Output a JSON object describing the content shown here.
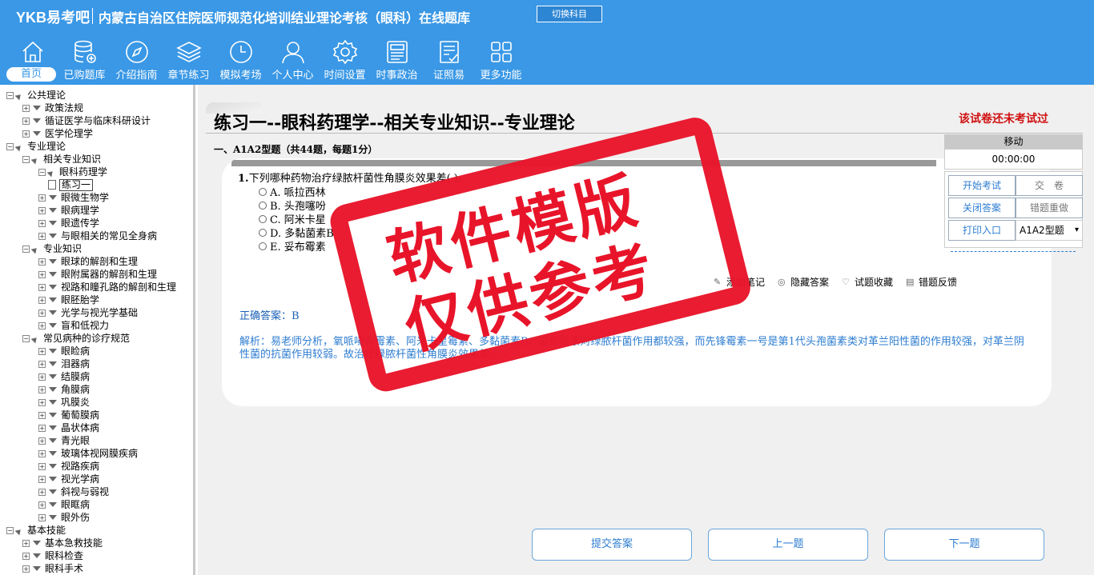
{
  "header": {
    "brand": "YKB易考吧",
    "title": "内蒙古自治区住院医师规范化培训结业理论考核（眼科）在线题库",
    "switch_label": "切换科目"
  },
  "nav": [
    {
      "label": "首页",
      "icon": "home-icon"
    },
    {
      "label": "已购题库",
      "icon": "database-icon"
    },
    {
      "label": "介绍指南",
      "icon": "compass-icon"
    },
    {
      "label": "章节练习",
      "icon": "layers-icon"
    },
    {
      "label": "模拟考场",
      "icon": "clock-icon"
    },
    {
      "label": "个人中心",
      "icon": "user-icon"
    },
    {
      "label": "时间设置",
      "icon": "gear-icon"
    },
    {
      "label": "时事政治",
      "icon": "news-icon"
    },
    {
      "label": "证照易",
      "icon": "certificate-icon"
    },
    {
      "label": "更多功能",
      "icon": "grid-icon"
    }
  ],
  "tree": [
    {
      "level": 0,
      "label": "公共理论",
      "box": "−",
      "tri": "open"
    },
    {
      "level": 1,
      "label": "政策法规",
      "box": "+",
      "tri": "closed"
    },
    {
      "level": 1,
      "label": "循证医学与临床科研设计",
      "box": "+",
      "tri": "closed"
    },
    {
      "level": 1,
      "label": "医学伦理学",
      "box": "+",
      "tri": "closed"
    },
    {
      "level": 0,
      "label": "专业理论",
      "box": "−",
      "tri": "open"
    },
    {
      "level": 1,
      "label": "相关专业知识",
      "box": "−",
      "tri": "open"
    },
    {
      "level": 2,
      "label": "眼科药理学",
      "box": "−",
      "tri": "open"
    },
    {
      "level": 3,
      "label": "练习一",
      "leaf": true
    },
    {
      "level": 2,
      "label": "眼微生物学",
      "box": "+",
      "tri": "closed"
    },
    {
      "level": 2,
      "label": "眼病理学",
      "box": "+",
      "tri": "closed"
    },
    {
      "level": 2,
      "label": "眼遗传学",
      "box": "+",
      "tri": "closed"
    },
    {
      "level": 2,
      "label": "与眼相关的常见全身病",
      "box": "+",
      "tri": "closed"
    },
    {
      "level": 1,
      "label": "专业知识",
      "box": "−",
      "tri": "open"
    },
    {
      "level": 2,
      "label": "眼球的解剖和生理",
      "box": "+",
      "tri": "closed"
    },
    {
      "level": 2,
      "label": "眼附属器的解剖和生理",
      "box": "+",
      "tri": "closed"
    },
    {
      "level": 2,
      "label": "视路和瞳孔路的解剖和生理",
      "box": "+",
      "tri": "closed"
    },
    {
      "level": 2,
      "label": "眼胚胎学",
      "box": "+",
      "tri": "closed"
    },
    {
      "level": 2,
      "label": "光学与视光学基础",
      "box": "+",
      "tri": "closed"
    },
    {
      "level": 2,
      "label": "盲和低视力",
      "box": "+",
      "tri": "closed"
    },
    {
      "level": 1,
      "label": "常见病种的诊疗规范",
      "box": "−",
      "tri": "open"
    },
    {
      "level": 2,
      "label": "眼睑病",
      "box": "+",
      "tri": "closed"
    },
    {
      "level": 2,
      "label": "泪器病",
      "box": "+",
      "tri": "closed"
    },
    {
      "level": 2,
      "label": "结膜病",
      "box": "+",
      "tri": "closed"
    },
    {
      "level": 2,
      "label": "角膜病",
      "box": "+",
      "tri": "closed"
    },
    {
      "level": 2,
      "label": "巩膜炎",
      "box": "+",
      "tri": "closed"
    },
    {
      "level": 2,
      "label": "葡萄膜病",
      "box": "+",
      "tri": "closed"
    },
    {
      "level": 2,
      "label": "晶状体病",
      "box": "+",
      "tri": "closed"
    },
    {
      "level": 2,
      "label": "青光眼",
      "box": "+",
      "tri": "closed"
    },
    {
      "level": 2,
      "label": "玻璃体视网膜疾病",
      "box": "+",
      "tri": "closed"
    },
    {
      "level": 2,
      "label": "视路疾病",
      "box": "+",
      "tri": "closed"
    },
    {
      "level": 2,
      "label": "视光学病",
      "box": "+",
      "tri": "closed"
    },
    {
      "level": 2,
      "label": "斜视与弱视",
      "box": "+",
      "tri": "closed"
    },
    {
      "level": 2,
      "label": "眼眶病",
      "box": "+",
      "tri": "closed"
    },
    {
      "level": 2,
      "label": "眼外伤",
      "box": "+",
      "tri": "closed"
    },
    {
      "level": 0,
      "label": "基本技能",
      "box": "−",
      "tri": "open"
    },
    {
      "level": 1,
      "label": "基本急救技能",
      "box": "+",
      "tri": "closed"
    },
    {
      "level": 1,
      "label": "眼科检查",
      "box": "+",
      "tri": "closed"
    },
    {
      "level": 1,
      "label": "眼科手术",
      "box": "+",
      "tri": "closed"
    }
  ],
  "exam": {
    "title": "练习一--眼科药理学--相关专业知识--专业理论",
    "status": "该试卷还未考试过",
    "section": "一、A1A2型题（共44题，每题1分）"
  },
  "question": {
    "number": "1.",
    "stem": "下列哪种药物治疗绿脓杆菌性角膜炎效果差(   )。",
    "options": [
      "A. 哌拉西林",
      "B. 头孢噻吩",
      "C. 阿米卡星",
      "D. 多黏菌素B",
      "E. 妥布霉素"
    ],
    "correct_label": "正确答案：B",
    "analysis": "解析：易老师分析，氧哌嗪青霉素、阿米卡星霉素、多黏菌素B、妥布霉素对绿脓杆菌作用都较强，而先锋霉素一号是第1代头孢菌素类对革兰阳性菌的作用较强，对革兰阴性菌的抗菌作用较弱。故治疗绿脓杆菌性角膜炎效果差。"
  },
  "tools": [
    {
      "label": "添加笔记",
      "icon": "pencil-icon",
      "glyph": "✎"
    },
    {
      "label": "隐藏答案",
      "icon": "eye-off-icon",
      "glyph": "◎"
    },
    {
      "label": "试题收藏",
      "icon": "heart-icon",
      "glyph": "♡"
    },
    {
      "label": "错题反馈",
      "icon": "feedback-icon",
      "glyph": "▤"
    }
  ],
  "panel": {
    "move": "移动",
    "timer": "00:00:00",
    "start": "开始考试",
    "submit": "交　卷",
    "close_answer": "关闭答案",
    "redo_wrong": "错题重做",
    "print": "打印入口",
    "type_selected": "A1A2型题"
  },
  "bottom": {
    "submit_answer": "提交答案",
    "prev": "上一题",
    "next": "下一题"
  },
  "stamp": {
    "line1": "软件模版",
    "line2": "仅供参考",
    "color": "#e8152a"
  },
  "colors": {
    "header_bg": "#3a98e6",
    "status_red": "#d01010",
    "link_blue": "#2e7dd1"
  }
}
